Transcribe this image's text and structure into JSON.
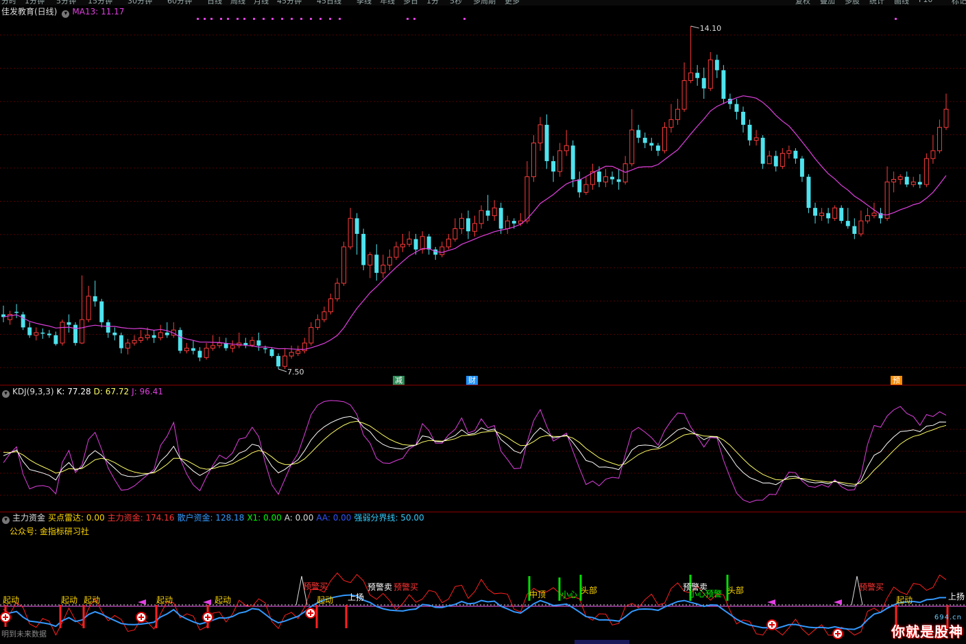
{
  "toolbar": {
    "periods": [
      "分时",
      "1分钟",
      "5分钟",
      "15分钟",
      "30分钟",
      "60分钟",
      "日线",
      "周线",
      "月线",
      "45分钟",
      "45日线",
      "季线",
      "年线",
      "多日",
      "1分",
      "5秒",
      "多周期",
      "更多"
    ],
    "right_buttons": [
      "复权",
      "叠加",
      "多股",
      "统计",
      "画线",
      "F10",
      "标记"
    ]
  },
  "main": {
    "title": "佳发教育(日线)",
    "ma_label": "MA13: 11.17",
    "ma_color": "#e040e0",
    "high_label": "14.10",
    "low_label": "7.50",
    "badges": [
      {
        "text": "减",
        "color": "#2e8b57"
      },
      {
        "text": "财",
        "color": "#1e90ff"
      },
      {
        "text": "预",
        "color": "#ff8c00"
      }
    ]
  },
  "kdj": {
    "title": "KDJ(9,3,3)",
    "k_label": "K: 77.28",
    "d_label": "D: 67.72",
    "j_label": "J: 96.41",
    "k_color": "#ffffff",
    "d_color": "#ffff66",
    "j_color": "#e040e0"
  },
  "flow": {
    "title": "主力资金",
    "items": [
      {
        "text": "买点雷达: 0.00",
        "color": "#ffd700"
      },
      {
        "text": "主力资金: 174.16",
        "color": "#ff3333"
      },
      {
        "text": "散户资金: 128.18",
        "color": "#3399ff"
      },
      {
        "text": "X1: 0.00",
        "color": "#00ff00"
      },
      {
        "text": "A: 0.00",
        "color": "#dddddd"
      },
      {
        "text": "AA: 0.00",
        "color": "#3355ff"
      },
      {
        "text": "强弱分界线: 50.00",
        "color": "#33ccff"
      }
    ],
    "gzh": "公众号: 金指标研习社",
    "future": "明到未来数据",
    "labels": [
      {
        "text": "起动",
        "color": "#ffd700"
      },
      {
        "text": "起动",
        "color": "#ffd700"
      },
      {
        "text": "起动",
        "color": "#ffd700"
      },
      {
        "text": "起动",
        "color": "#ffd700"
      },
      {
        "text": "起动",
        "color": "#ffd700"
      },
      {
        "text": "起动",
        "color": "#ffd700"
      },
      {
        "text": "起动",
        "color": "#ffd700"
      },
      {
        "text": "起动",
        "color": "#ffd700"
      },
      {
        "text": "预警买",
        "color": "#ff3333"
      },
      {
        "text": "上扬",
        "color": "#ffffff"
      },
      {
        "text": "预警卖",
        "color": "#ffffff"
      },
      {
        "text": "预警买",
        "color": "#ff3333"
      },
      {
        "text": "中顶",
        "color": "#ffd700"
      },
      {
        "text": "小心",
        "color": "#00ff00"
      },
      {
        "text": "头部",
        "color": "#ffd700"
      },
      {
        "text": "预警卖",
        "color": "#ffffff"
      },
      {
        "text": "小心预警",
        "color": "#00ff00"
      },
      {
        "text": "头部",
        "color": "#ffd700"
      },
      {
        "text": "预警买",
        "color": "#ff3333"
      },
      {
        "text": "上扬",
        "color": "#ffffff"
      }
    ]
  },
  "watermark": {
    "text": "你就是股神",
    "site": "694.cn"
  },
  "chart_data": [
    {
      "type": "candlestick",
      "title": "佳发教育(日线)",
      "ma13_last": 11.17,
      "high": 14.1,
      "low": 7.5,
      "candles": [
        [
          8.55,
          8.5,
          8.72,
          8.4
        ],
        [
          8.45,
          8.55,
          8.62,
          8.35
        ],
        [
          8.6,
          8.58,
          8.75,
          8.48
        ],
        [
          8.55,
          8.3,
          8.6,
          8.25
        ],
        [
          8.3,
          8.15,
          8.4,
          8.1
        ],
        [
          8.15,
          8.2,
          8.3,
          8.05
        ],
        [
          8.2,
          8.18,
          8.28,
          8.08
        ],
        [
          8.18,
          8.15,
          8.25,
          8.1
        ],
        [
          8.15,
          7.98,
          8.22,
          7.95
        ],
        [
          8.0,
          8.4,
          8.45,
          7.95
        ],
        [
          8.4,
          8.35,
          8.55,
          8.2
        ],
        [
          8.35,
          8.0,
          8.4,
          7.95
        ],
        [
          8.0,
          8.45,
          9.3,
          7.98
        ],
        [
          8.45,
          8.9,
          9.1,
          8.4
        ],
        [
          8.9,
          8.8,
          9.2,
          8.7
        ],
        [
          8.8,
          8.4,
          8.85,
          8.3
        ],
        [
          8.4,
          8.2,
          8.45,
          8.1
        ],
        [
          8.2,
          8.15,
          8.3,
          8.05
        ],
        [
          8.15,
          7.9,
          8.2,
          7.8
        ],
        [
          7.9,
          8.0,
          8.08,
          7.78
        ],
        [
          8.0,
          8.05,
          8.15,
          7.95
        ],
        [
          8.05,
          8.1,
          8.25,
          8.0
        ],
        [
          8.1,
          8.15,
          8.3,
          8.05
        ],
        [
          8.15,
          8.1,
          8.25,
          8.0
        ],
        [
          8.1,
          8.2,
          8.35,
          8.05
        ],
        [
          8.2,
          8.15,
          8.4,
          8.1
        ],
        [
          8.15,
          8.25,
          8.4,
          8.1
        ],
        [
          8.25,
          7.85,
          8.3,
          7.8
        ],
        [
          7.85,
          7.9,
          8.0,
          7.8
        ],
        [
          7.9,
          7.85,
          8.05,
          7.78
        ],
        [
          7.85,
          7.72,
          7.92,
          7.65
        ],
        [
          7.72,
          7.9,
          8.0,
          7.68
        ],
        [
          7.9,
          7.95,
          8.15,
          7.85
        ],
        [
          7.95,
          8.0,
          8.12,
          7.9
        ],
        [
          8.0,
          7.9,
          8.1,
          7.85
        ],
        [
          7.9,
          7.95,
          8.05,
          7.82
        ],
        [
          7.95,
          8.0,
          8.2,
          7.9
        ],
        [
          8.0,
          7.96,
          8.1,
          7.9
        ],
        [
          7.96,
          8.05,
          8.12,
          7.92
        ],
        [
          8.05,
          7.95,
          8.2,
          7.85
        ],
        [
          7.9,
          7.88,
          7.95,
          7.8
        ],
        [
          7.88,
          7.75,
          7.92,
          7.72
        ],
        [
          7.75,
          7.55,
          7.8,
          7.5
        ],
        [
          7.55,
          7.75,
          7.9,
          7.5
        ],
        [
          7.75,
          7.82,
          7.95,
          7.7
        ],
        [
          7.8,
          7.85,
          7.95,
          7.75
        ],
        [
          7.85,
          8.0,
          8.1,
          7.8
        ],
        [
          8.0,
          8.3,
          8.4,
          7.95
        ],
        [
          8.3,
          8.45,
          8.55,
          8.25
        ],
        [
          8.45,
          8.6,
          8.7,
          8.4
        ],
        [
          8.6,
          8.85,
          8.95,
          8.55
        ],
        [
          8.85,
          9.15,
          9.25,
          8.8
        ],
        [
          9.15,
          9.85,
          9.95,
          9.1
        ],
        [
          9.85,
          10.4,
          10.6,
          9.8
        ],
        [
          10.4,
          10.1,
          10.5,
          9.7
        ],
        [
          10.1,
          9.5,
          10.2,
          9.4
        ],
        [
          9.5,
          9.7,
          9.75,
          9.25
        ],
        [
          9.7,
          9.35,
          9.9,
          9.2
        ],
        [
          9.35,
          9.5,
          9.7,
          9.25
        ],
        [
          9.5,
          9.65,
          9.8,
          9.4
        ],
        [
          9.65,
          9.85,
          9.95,
          9.6
        ],
        [
          9.85,
          9.9,
          10.1,
          9.75
        ],
        [
          9.9,
          10.0,
          10.15,
          9.85
        ],
        [
          10.0,
          9.8,
          10.1,
          9.7
        ],
        [
          9.8,
          10.05,
          10.15,
          9.72
        ],
        [
          10.05,
          9.8,
          10.1,
          9.7
        ],
        [
          9.8,
          9.7,
          9.85,
          9.6
        ],
        [
          9.7,
          9.85,
          9.95,
          9.65
        ],
        [
          9.85,
          10.0,
          10.1,
          9.8
        ],
        [
          10.0,
          10.2,
          10.4,
          9.95
        ],
        [
          10.2,
          10.4,
          10.5,
          10.1
        ],
        [
          10.4,
          10.15,
          10.55,
          10.0
        ],
        [
          10.15,
          10.3,
          10.45,
          10.05
        ],
        [
          10.3,
          10.55,
          10.65,
          10.2
        ],
        [
          10.55,
          10.45,
          10.85,
          10.35
        ],
        [
          10.45,
          10.6,
          10.75,
          10.35
        ],
        [
          10.6,
          10.2,
          10.7,
          10.1
        ],
        [
          10.2,
          10.35,
          10.45,
          10.1
        ],
        [
          10.35,
          10.3,
          10.4,
          10.2
        ],
        [
          10.3,
          10.35,
          10.5,
          10.25
        ],
        [
          10.35,
          11.2,
          11.5,
          10.3
        ],
        [
          11.2,
          11.85,
          12.0,
          11.1
        ],
        [
          11.85,
          12.2,
          12.35,
          11.7
        ],
        [
          12.2,
          11.5,
          12.4,
          11.35
        ],
        [
          11.5,
          11.3,
          11.6,
          11.1
        ],
        [
          11.3,
          11.7,
          11.85,
          11.2
        ],
        [
          11.7,
          11.8,
          12.1,
          11.6
        ],
        [
          11.8,
          11.15,
          11.9,
          11.0
        ],
        [
          11.15,
          10.9,
          11.3,
          10.8
        ],
        [
          10.9,
          11.05,
          11.2,
          10.85
        ],
        [
          11.05,
          11.3,
          11.45,
          10.95
        ],
        [
          11.3,
          11.1,
          11.4,
          11.0
        ],
        [
          11.1,
          11.2,
          11.35,
          11.0
        ],
        [
          11.2,
          11.15,
          11.3,
          11.05
        ],
        [
          11.15,
          11.1,
          11.35,
          10.95
        ],
        [
          11.1,
          11.45,
          11.6,
          11.05
        ],
        [
          11.45,
          12.1,
          12.5,
          11.4
        ],
        [
          12.1,
          11.95,
          12.2,
          11.85
        ],
        [
          11.95,
          11.85,
          12.05,
          11.75
        ],
        [
          11.85,
          11.8,
          11.95,
          11.7
        ],
        [
          11.8,
          11.7,
          11.85,
          11.6
        ],
        [
          11.7,
          12.15,
          12.25,
          11.65
        ],
        [
          12.15,
          12.3,
          12.6,
          12.05
        ],
        [
          12.3,
          12.5,
          12.7,
          12.2
        ],
        [
          12.5,
          13.05,
          13.4,
          12.45
        ],
        [
          13.05,
          13.2,
          14.1,
          13.0
        ],
        [
          13.2,
          13.1,
          13.35,
          12.95
        ],
        [
          13.1,
          12.9,
          13.3,
          12.7
        ],
        [
          12.9,
          13.45,
          13.6,
          12.85
        ],
        [
          13.45,
          13.25,
          13.55,
          13.1
        ],
        [
          13.25,
          12.7,
          13.35,
          12.6
        ],
        [
          12.7,
          12.6,
          12.8,
          12.5
        ],
        [
          12.6,
          12.45,
          12.7,
          12.3
        ],
        [
          12.45,
          12.2,
          12.55,
          12.05
        ],
        [
          12.2,
          11.9,
          12.3,
          11.8
        ],
        [
          11.9,
          11.95,
          12.1,
          11.8
        ],
        [
          11.95,
          11.45,
          12.0,
          11.35
        ],
        [
          11.45,
          11.6,
          11.7,
          11.5
        ],
        [
          11.6,
          11.4,
          11.7,
          11.3
        ],
        [
          11.4,
          11.65,
          11.75,
          11.35
        ],
        [
          11.65,
          11.7,
          11.8,
          11.55
        ],
        [
          11.7,
          11.55,
          11.75,
          11.45
        ],
        [
          11.55,
          11.2,
          11.6,
          11.1
        ],
        [
          11.2,
          10.6,
          11.25,
          10.5
        ],
        [
          10.6,
          10.45,
          10.7,
          10.3
        ],
        [
          10.45,
          10.5,
          10.6,
          10.35
        ],
        [
          10.5,
          10.4,
          10.6,
          10.3
        ],
        [
          10.4,
          10.6,
          10.65,
          10.35
        ],
        [
          10.6,
          10.35,
          10.65,
          10.3
        ],
        [
          10.35,
          10.25,
          10.6,
          10.2
        ],
        [
          10.25,
          10.1,
          10.4,
          10.0
        ],
        [
          10.1,
          10.35,
          10.55,
          10.05
        ],
        [
          10.35,
          10.45,
          10.6,
          10.3
        ],
        [
          10.45,
          10.5,
          10.7,
          10.4
        ],
        [
          10.5,
          10.4,
          10.6,
          10.3
        ],
        [
          10.4,
          11.1,
          11.4,
          10.35
        ],
        [
          11.1,
          11.15,
          11.3,
          10.9
        ],
        [
          11.15,
          11.2,
          11.25,
          11.05
        ],
        [
          11.2,
          11.05,
          11.3,
          11.0
        ],
        [
          11.05,
          11.1,
          11.2,
          11.0
        ],
        [
          11.1,
          11.05,
          11.25,
          10.98
        ],
        [
          11.05,
          11.55,
          11.65,
          11.0
        ],
        [
          11.55,
          11.7,
          12.0,
          11.45
        ],
        [
          11.7,
          12.15,
          12.3,
          11.65
        ],
        [
          12.15,
          12.5,
          12.8,
          12.1
        ]
      ]
    },
    {
      "type": "line",
      "title": "KDJ(9,3,3)",
      "series": [
        {
          "name": "K",
          "last": 77.28
        },
        {
          "name": "D",
          "last": 67.72
        },
        {
          "name": "J",
          "last": 96.41
        }
      ]
    },
    {
      "type": "line",
      "title": "主力资金",
      "series": [
        {
          "name": "主力资金",
          "last": 174.16
        },
        {
          "name": "散户资金",
          "last": 128.18
        },
        {
          "name": "强弱分界线",
          "last": 50.0
        }
      ]
    }
  ]
}
